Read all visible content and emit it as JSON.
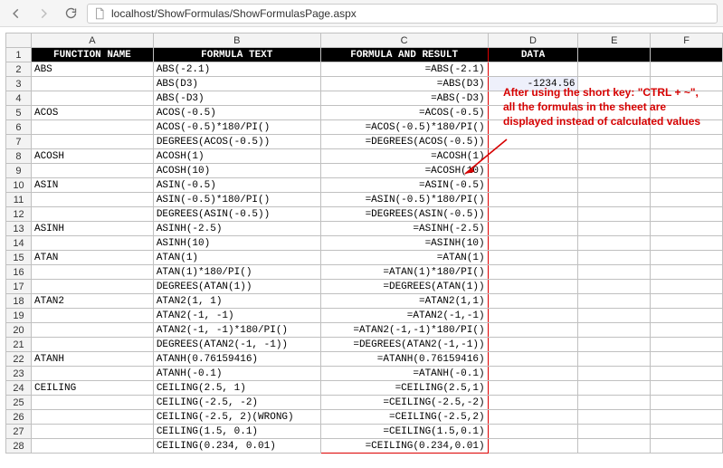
{
  "browser": {
    "url": "localhost/ShowFormulas/ShowFormulasPage.aspx"
  },
  "annotation": {
    "text": "After using the short key: \"CTRL + ~\", all the formulas in the sheet are displayed instead of calculated values"
  },
  "columns": [
    "A",
    "B",
    "C",
    "D",
    "E",
    "F"
  ],
  "header_row": {
    "A": "FUNCTION NAME",
    "B": "FORMULA TEXT",
    "C": "FORMULA AND RESULT",
    "D": "DATA",
    "E": "",
    "F": ""
  },
  "rows": [
    {
      "n": "2",
      "A": "ABS",
      "B": "ABS(-2.1)",
      "C": "=ABS(-2.1)",
      "D": ""
    },
    {
      "n": "3",
      "A": "",
      "B": "ABS(D3)",
      "C": "=ABS(D3)",
      "D": "-1234.56",
      "hiD": true
    },
    {
      "n": "4",
      "A": "",
      "B": "ABS(-D3)",
      "C": "=ABS(-D3)",
      "D": ""
    },
    {
      "n": "5",
      "A": "ACOS",
      "B": "ACOS(-0.5)",
      "C": "=ACOS(-0.5)",
      "D": ""
    },
    {
      "n": "6",
      "A": "",
      "B": "ACOS(-0.5)*180/PI()",
      "C": "=ACOS(-0.5)*180/PI()",
      "D": ""
    },
    {
      "n": "7",
      "A": "",
      "B": "DEGREES(ACOS(-0.5))",
      "C": "=DEGREES(ACOS(-0.5))",
      "D": ""
    },
    {
      "n": "8",
      "A": "ACOSH",
      "B": "ACOSH(1)",
      "C": "=ACOSH(1)",
      "D": ""
    },
    {
      "n": "9",
      "A": "",
      "B": "ACOSH(10)",
      "C": "=ACOSH(10)",
      "D": ""
    },
    {
      "n": "10",
      "A": "ASIN",
      "B": "ASIN(-0.5)",
      "C": "=ASIN(-0.5)",
      "D": ""
    },
    {
      "n": "11",
      "A": "",
      "B": "ASIN(-0.5)*180/PI()",
      "C": "=ASIN(-0.5)*180/PI()",
      "D": ""
    },
    {
      "n": "12",
      "A": "",
      "B": "DEGREES(ASIN(-0.5))",
      "C": "=DEGREES(ASIN(-0.5))",
      "D": ""
    },
    {
      "n": "13",
      "A": "ASINH",
      "B": "ASINH(-2.5)",
      "C": "=ASINH(-2.5)",
      "D": ""
    },
    {
      "n": "14",
      "A": "",
      "B": "ASINH(10)",
      "C": "=ASINH(10)",
      "D": ""
    },
    {
      "n": "15",
      "A": "ATAN",
      "B": "ATAN(1)",
      "C": "=ATAN(1)",
      "D": ""
    },
    {
      "n": "16",
      "A": "",
      "B": "ATAN(1)*180/PI()",
      "C": "=ATAN(1)*180/PI()",
      "D": ""
    },
    {
      "n": "17",
      "A": "",
      "B": "DEGREES(ATAN(1))",
      "C": "=DEGREES(ATAN(1))",
      "D": ""
    },
    {
      "n": "18",
      "A": "ATAN2",
      "B": "ATAN2(1, 1)",
      "C": "=ATAN2(1,1)",
      "D": ""
    },
    {
      "n": "19",
      "A": "",
      "B": "ATAN2(-1, -1)",
      "C": "=ATAN2(-1,-1)",
      "D": ""
    },
    {
      "n": "20",
      "A": "",
      "B": "ATAN2(-1, -1)*180/PI()",
      "C": "=ATAN2(-1,-1)*180/PI()",
      "D": ""
    },
    {
      "n": "21",
      "A": "",
      "B": "DEGREES(ATAN2(-1, -1))",
      "C": "=DEGREES(ATAN2(-1,-1))",
      "D": ""
    },
    {
      "n": "22",
      "A": "ATANH",
      "B": "ATANH(0.76159416)",
      "C": "=ATANH(0.76159416)",
      "D": ""
    },
    {
      "n": "23",
      "A": "",
      "B": "ATANH(-0.1)",
      "C": "=ATANH(-0.1)",
      "D": ""
    },
    {
      "n": "24",
      "A": "CEILING",
      "B": "CEILING(2.5, 1)",
      "C": "=CEILING(2.5,1)",
      "D": ""
    },
    {
      "n": "25",
      "A": "",
      "B": "CEILING(-2.5, -2)",
      "C": "=CEILING(-2.5,-2)",
      "D": ""
    },
    {
      "n": "26",
      "A": "",
      "B": "CEILING(-2.5, 2)(WRONG)",
      "C": "=CEILING(-2.5,2)",
      "D": ""
    },
    {
      "n": "27",
      "A": "",
      "B": "CEILING(1.5, 0.1)",
      "C": "=CEILING(1.5,0.1)",
      "D": ""
    },
    {
      "n": "28",
      "A": "",
      "B": "CEILING(0.234, 0.01)",
      "C": "=CEILING(0.234,0.01)",
      "D": ""
    }
  ]
}
